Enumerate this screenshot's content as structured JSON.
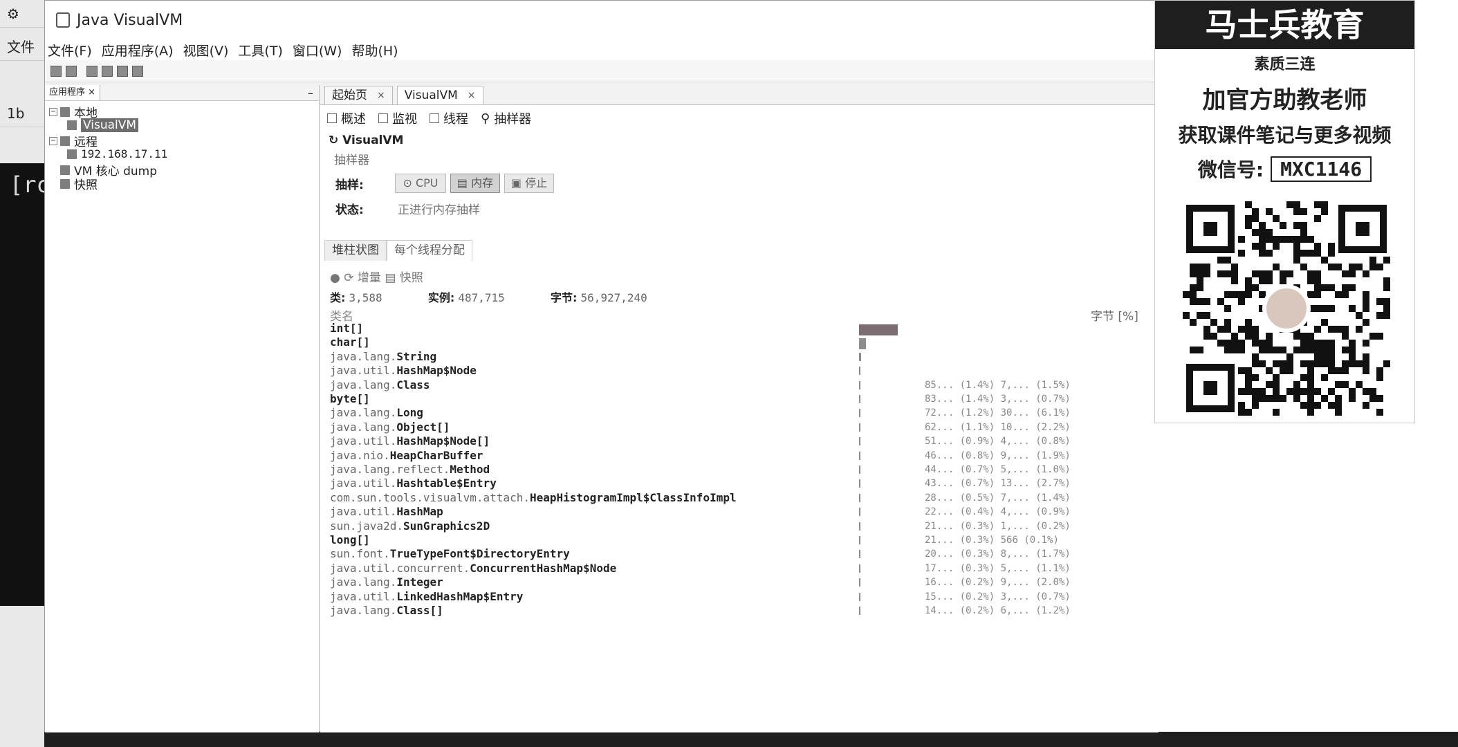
{
  "terminal": {
    "labels": [
      "文件",
      "1b",
      "[rc"
    ]
  },
  "window": {
    "title": "Java VisualVM",
    "menu": [
      "文件(F)",
      "应用程序(A)",
      "视图(V)",
      "工具(T)",
      "窗口(W)",
      "帮助(H)"
    ]
  },
  "left_panel": {
    "tab_label": "应用程序",
    "tree": [
      {
        "label": "本地",
        "level": 0
      },
      {
        "label": "VisualVM",
        "level": 1,
        "selected": true
      },
      {
        "label": "远程",
        "level": 0
      },
      {
        "label": "192.168.17.11",
        "level": 1
      },
      {
        "label": "VM 核心 dump",
        "level": 0
      },
      {
        "label": "快照",
        "level": 0
      }
    ]
  },
  "content": {
    "doc_tabs": [
      "起始页",
      "VisualVM"
    ],
    "sub_tabs": [
      "概述",
      "监视",
      "线程",
      "抽样器"
    ],
    "app_title": "VisualVM",
    "section": "抽样器",
    "sample_label": "抽样:",
    "buttons": {
      "cpu": "CPU",
      "memory": "内存",
      "stop": "停止"
    },
    "status_label": "状态:",
    "status_value": "正进行内存抽样",
    "view_tabs": [
      "堆柱状图",
      "每个线程分配"
    ],
    "toolbar": {
      "delta": "增量",
      "snapshot": "快照"
    },
    "stats": {
      "classes_label": "类:",
      "classes": "3,588",
      "instances_label": "实例:",
      "instances": "487,715",
      "bytes_label": "字节:",
      "bytes": "56,927,240"
    },
    "col_classname": "类名",
    "col_bytes": "字节 [%]",
    "rows": [
      {
        "pkg": "",
        "cls": "int[]",
        "n1": "",
        "p1": "",
        "n2": "",
        "p2": ""
      },
      {
        "pkg": "",
        "cls": "char[]",
        "n1": "",
        "p1": "",
        "n2": "",
        "p2": ""
      },
      {
        "pkg": "java.lang.",
        "cls": "String",
        "n1": "",
        "p1": "",
        "n2": "",
        "p2": ""
      },
      {
        "pkg": "java.util.",
        "cls": "HashMap$Node",
        "n1": "",
        "p1": "",
        "n2": "",
        "p2": ""
      },
      {
        "pkg": "java.lang.",
        "cls": "Class",
        "n1": "85...",
        "p1": "(1.4%)",
        "n2": "7,...",
        "p2": "(1.5%)"
      },
      {
        "pkg": "",
        "cls": "byte[]",
        "n1": "83...",
        "p1": "(1.4%)",
        "n2": "3,...",
        "p2": "(0.7%)"
      },
      {
        "pkg": "java.lang.",
        "cls": "Long",
        "n1": "72...",
        "p1": "(1.2%)",
        "n2": "30...",
        "p2": "(6.1%)"
      },
      {
        "pkg": "java.lang.",
        "cls": "Object[]",
        "n1": "62...",
        "p1": "(1.1%)",
        "n2": "10...",
        "p2": "(2.2%)"
      },
      {
        "pkg": "java.util.",
        "cls": "HashMap$Node[]",
        "n1": "51...",
        "p1": "(0.9%)",
        "n2": "4,...",
        "p2": "(0.8%)"
      },
      {
        "pkg": "java.nio.",
        "cls": "HeapCharBuffer",
        "n1": "46...",
        "p1": "(0.8%)",
        "n2": "9,...",
        "p2": "(1.9%)"
      },
      {
        "pkg": "java.lang.reflect.",
        "cls": "Method",
        "n1": "44...",
        "p1": "(0.7%)",
        "n2": "5,...",
        "p2": "(1.0%)"
      },
      {
        "pkg": "java.util.",
        "cls": "Hashtable$Entry",
        "n1": "43...",
        "p1": "(0.7%)",
        "n2": "13...",
        "p2": "(2.7%)"
      },
      {
        "pkg": "com.sun.tools.visualvm.attach.",
        "cls": "HeapHistogramImpl$ClassInfoImpl",
        "n1": "28...",
        "p1": "(0.5%)",
        "n2": "7,...",
        "p2": "(1.4%)"
      },
      {
        "pkg": "java.util.",
        "cls": "HashMap",
        "n1": "22...",
        "p1": "(0.4%)",
        "n2": "4,...",
        "p2": "(0.9%)"
      },
      {
        "pkg": "sun.java2d.",
        "cls": "SunGraphics2D",
        "n1": "21...",
        "p1": "(0.3%)",
        "n2": "1,...",
        "p2": "(0.2%)"
      },
      {
        "pkg": "",
        "cls": "long[]",
        "n1": "21...",
        "p1": "(0.3%)",
        "n2": "566",
        "p2": "(0.1%)"
      },
      {
        "pkg": "sun.font.",
        "cls": "TrueTypeFont$DirectoryEntry",
        "n1": "20...",
        "p1": "(0.3%)",
        "n2": "8,...",
        "p2": "(1.7%)"
      },
      {
        "pkg": "java.util.concurrent.",
        "cls": "ConcurrentHashMap$Node",
        "n1": "17...",
        "p1": "(0.3%)",
        "n2": "5,...",
        "p2": "(1.1%)"
      },
      {
        "pkg": "java.lang.",
        "cls": "Integer",
        "n1": "16...",
        "p1": "(0.2%)",
        "n2": "9,...",
        "p2": "(2.0%)"
      },
      {
        "pkg": "java.util.",
        "cls": "LinkedHashMap$Entry",
        "n1": "15...",
        "p1": "(0.2%)",
        "n2": "3,...",
        "p2": "(0.7%)"
      },
      {
        "pkg": "java.lang.",
        "cls": "Class[]",
        "n1": "14...",
        "p1": "(0.2%)",
        "n2": "6,...",
        "p2": "(1.2%)"
      }
    ]
  },
  "promo": {
    "brand": "马士兵教育",
    "line1": "素质三连",
    "line2": "加官方助教老师",
    "line3": "获取课件笔记与更多视频",
    "wechat_label": "微信号:",
    "wechat_id": "MXC1146"
  }
}
